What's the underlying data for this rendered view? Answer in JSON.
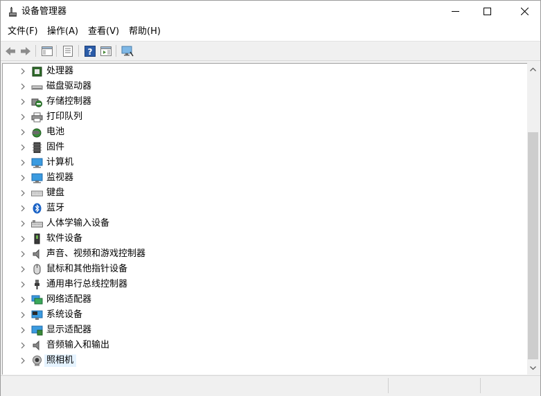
{
  "window": {
    "title": "设备管理器"
  },
  "menu": [
    {
      "label": "文件(F)"
    },
    {
      "label": "操作(A)"
    },
    {
      "label": "查看(V)"
    },
    {
      "label": "帮助(H)"
    }
  ],
  "toolbar": [
    "back-icon",
    "forward-icon",
    "show-hide-console-tree-icon",
    "properties-icon",
    "help-icon",
    "action-pane-icon",
    "scan-hardware-icon"
  ],
  "tree": {
    "items": [
      {
        "label": "处理器",
        "icon": "processor-icon"
      },
      {
        "label": "磁盘驱动器",
        "icon": "disk-drive-icon"
      },
      {
        "label": "存储控制器",
        "icon": "storage-controller-icon"
      },
      {
        "label": "打印队列",
        "icon": "printer-icon"
      },
      {
        "label": "电池",
        "icon": "battery-icon"
      },
      {
        "label": "固件",
        "icon": "firmware-icon"
      },
      {
        "label": "计算机",
        "icon": "computer-icon"
      },
      {
        "label": "监视器",
        "icon": "monitor-icon"
      },
      {
        "label": "键盘",
        "icon": "keyboard-icon"
      },
      {
        "label": "蓝牙",
        "icon": "bluetooth-icon"
      },
      {
        "label": "人体学输入设备",
        "icon": "hid-icon"
      },
      {
        "label": "软件设备",
        "icon": "software-device-icon"
      },
      {
        "label": "声音、视频和游戏控制器",
        "icon": "sound-icon"
      },
      {
        "label": "鼠标和其他指针设备",
        "icon": "mouse-icon"
      },
      {
        "label": "通用串行总线控制器",
        "icon": "usb-icon"
      },
      {
        "label": "网络适配器",
        "icon": "network-adapter-icon"
      },
      {
        "label": "系统设备",
        "icon": "system-device-icon"
      },
      {
        "label": "显示适配器",
        "icon": "display-adapter-icon"
      },
      {
        "label": "音频输入和输出",
        "icon": "audio-io-icon"
      },
      {
        "label": "照相机",
        "icon": "camera-icon",
        "selected": true
      }
    ]
  },
  "colors": {
    "selection": "#e5f3ff",
    "accent": "#0078d7"
  }
}
